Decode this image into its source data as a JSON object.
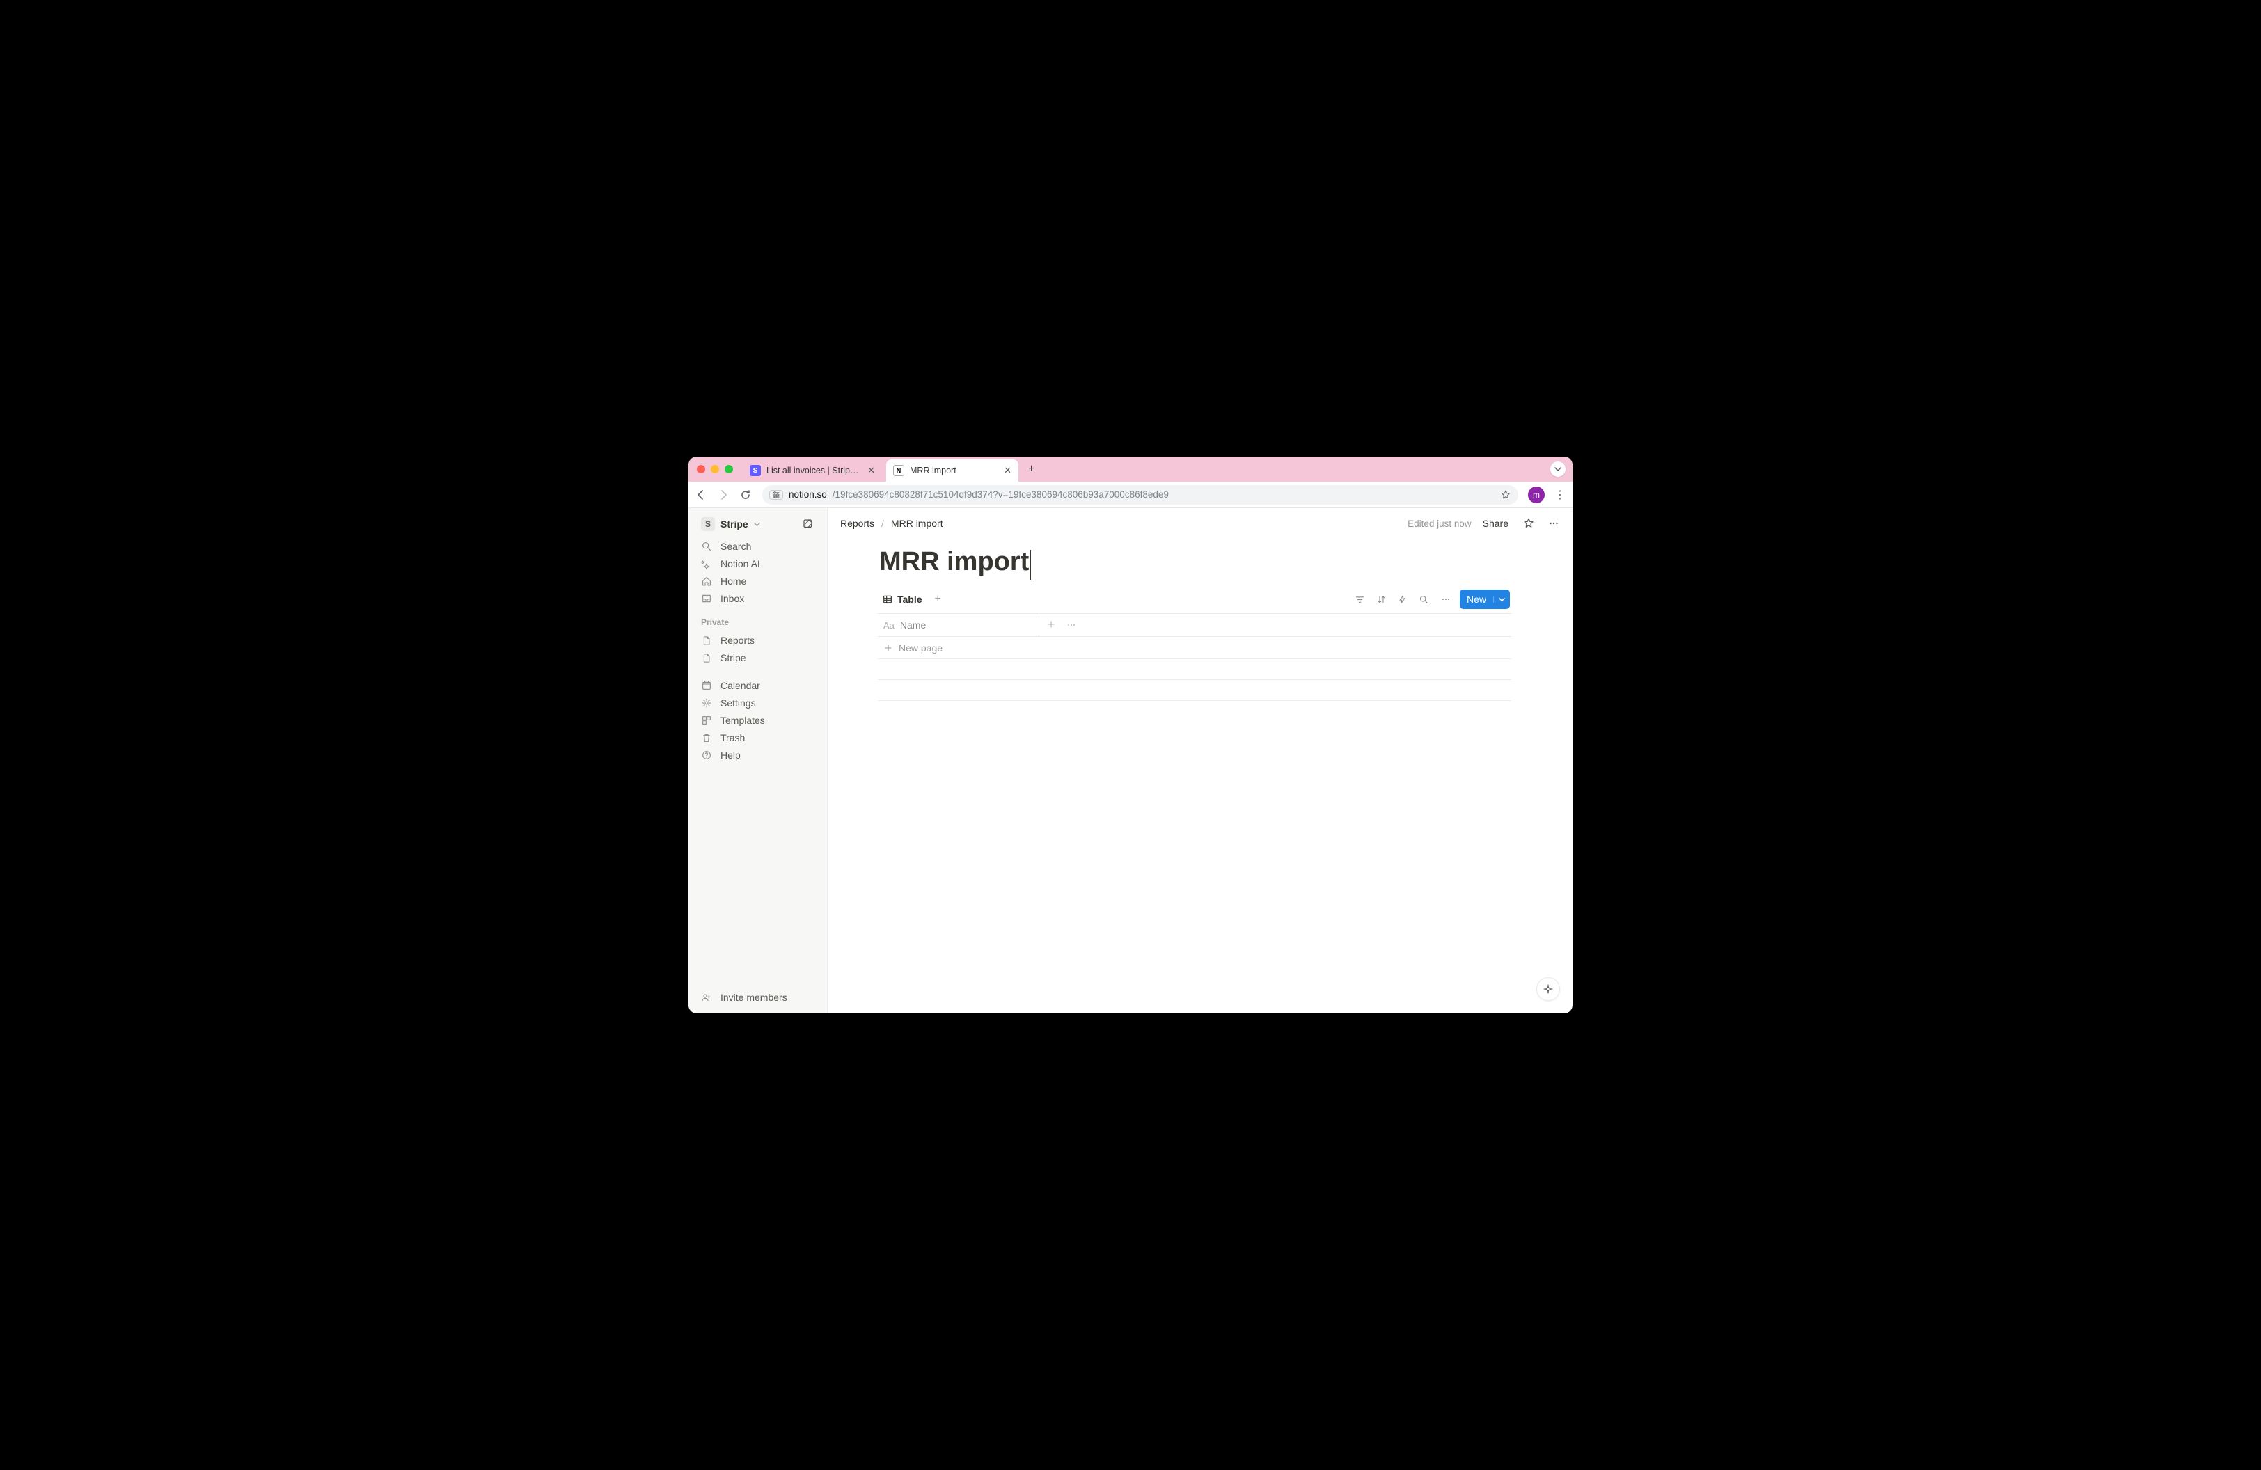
{
  "browser": {
    "tabs": [
      {
        "title": "List all invoices | Stripe API R",
        "favicon": "S",
        "active": false
      },
      {
        "title": "MRR import",
        "favicon": "N",
        "active": true
      }
    ],
    "url_domain": "notion.so",
    "url_path": "/19fce380694c80828f71c5104df9d374?v=19fce380694c806b93a7000c86f8ede9",
    "profile_initial": "m"
  },
  "sidebar": {
    "workspace": "Stripe",
    "workspace_initial": "S",
    "nav": [
      {
        "label": "Search",
        "icon": "search"
      },
      {
        "label": "Notion AI",
        "icon": "sparkle"
      },
      {
        "label": "Home",
        "icon": "home"
      },
      {
        "label": "Inbox",
        "icon": "inbox"
      }
    ],
    "private_label": "Private",
    "private_pages": [
      {
        "label": "Reports",
        "icon": "page"
      },
      {
        "label": "Stripe",
        "icon": "page"
      }
    ],
    "utility": [
      {
        "label": "Calendar",
        "icon": "calendar"
      },
      {
        "label": "Settings",
        "icon": "gear"
      },
      {
        "label": "Templates",
        "icon": "templates"
      },
      {
        "label": "Trash",
        "icon": "trash"
      },
      {
        "label": "Help",
        "icon": "help"
      }
    ],
    "invite_label": "Invite members"
  },
  "topbar": {
    "breadcrumb": [
      "Reports",
      "MRR import"
    ],
    "edited": "Edited just now",
    "share": "Share"
  },
  "page": {
    "title": "MRR import",
    "view_label": "Table",
    "new_button": "New",
    "column_name_label": "Name",
    "new_page_label": "New page"
  }
}
